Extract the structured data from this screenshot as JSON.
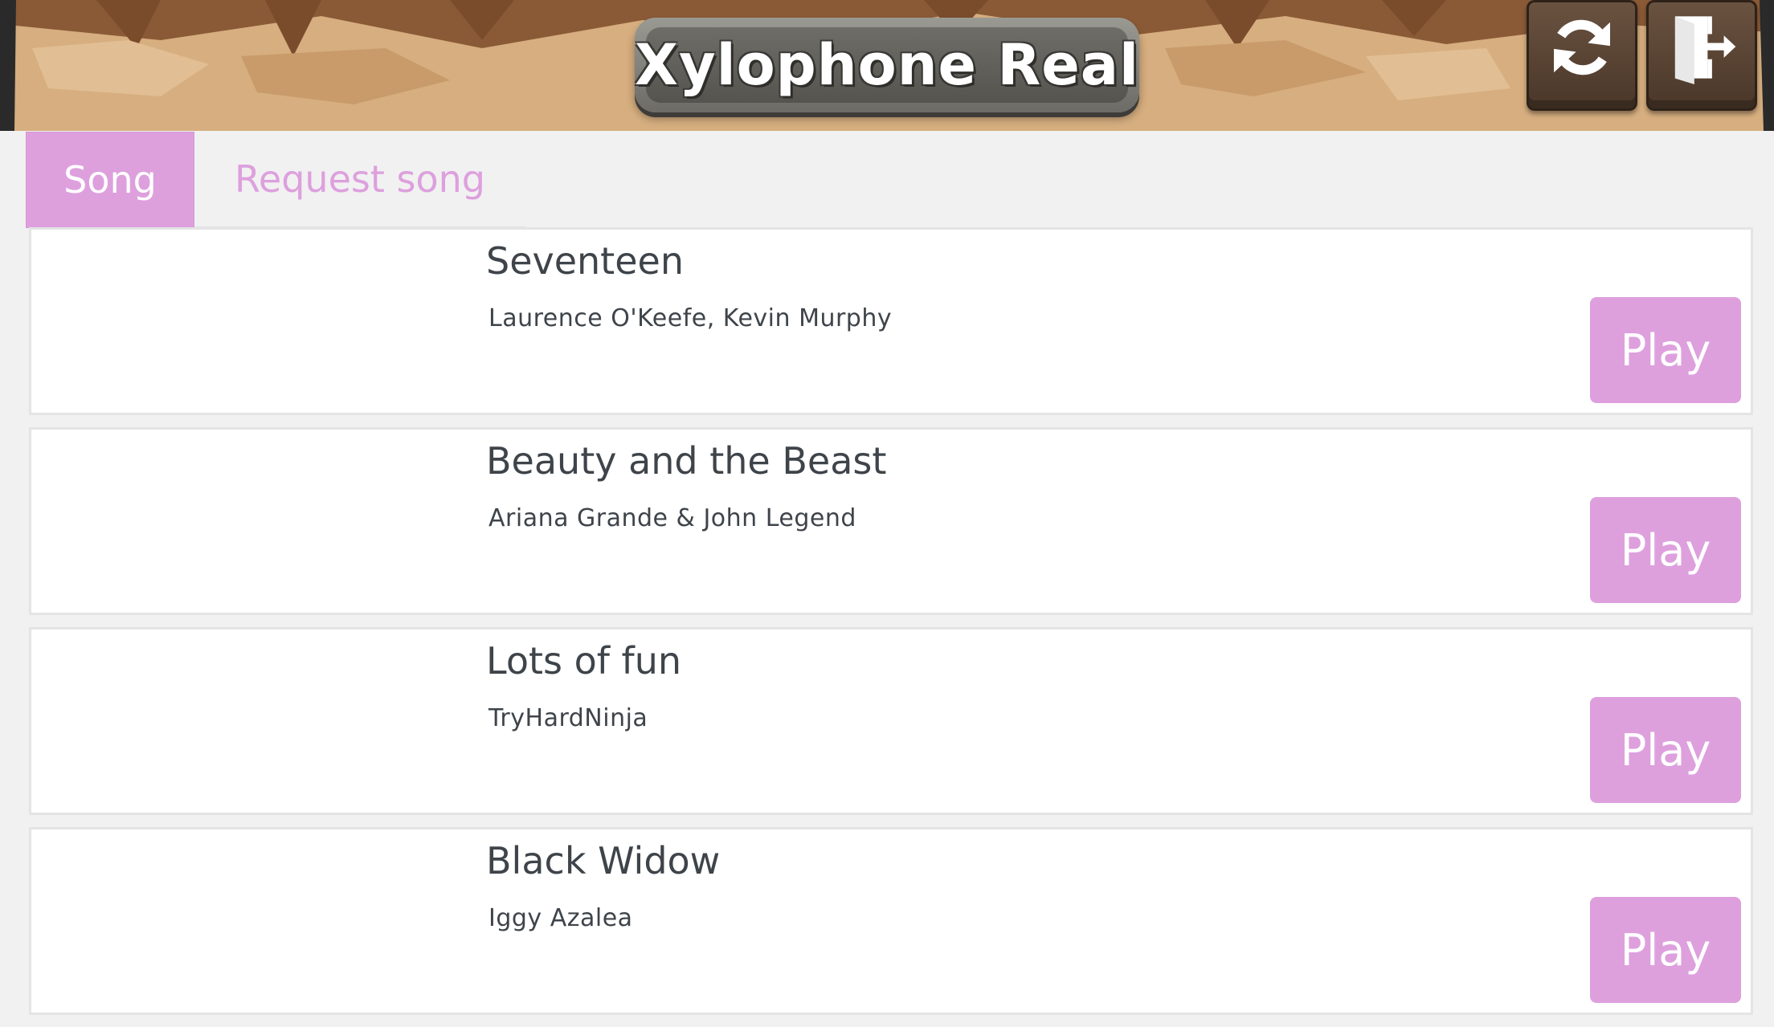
{
  "header": {
    "title": "Xylophone Real",
    "refresh_icon": "refresh-icon",
    "exit_icon": "exit-door-icon"
  },
  "tabs": [
    {
      "label": "Song",
      "active": true
    },
    {
      "label": "Request song",
      "active": false
    }
  ],
  "songs": [
    {
      "title": "Seventeen",
      "artist": "Laurence O'Keefe, Kevin Murphy",
      "button": "Play"
    },
    {
      "title": "Beauty and the Beast",
      "artist": "Ariana Grande & John Legend",
      "button": "Play"
    },
    {
      "title": "Lots of fun",
      "artist": "TryHardNinja",
      "button": "Play"
    },
    {
      "title": "Black Widow",
      "artist": "Iggy Azalea",
      "button": "Play"
    }
  ],
  "colors": {
    "accent": "#dda0dd",
    "text": "#3e444a",
    "header_bg": "#d7b083"
  }
}
